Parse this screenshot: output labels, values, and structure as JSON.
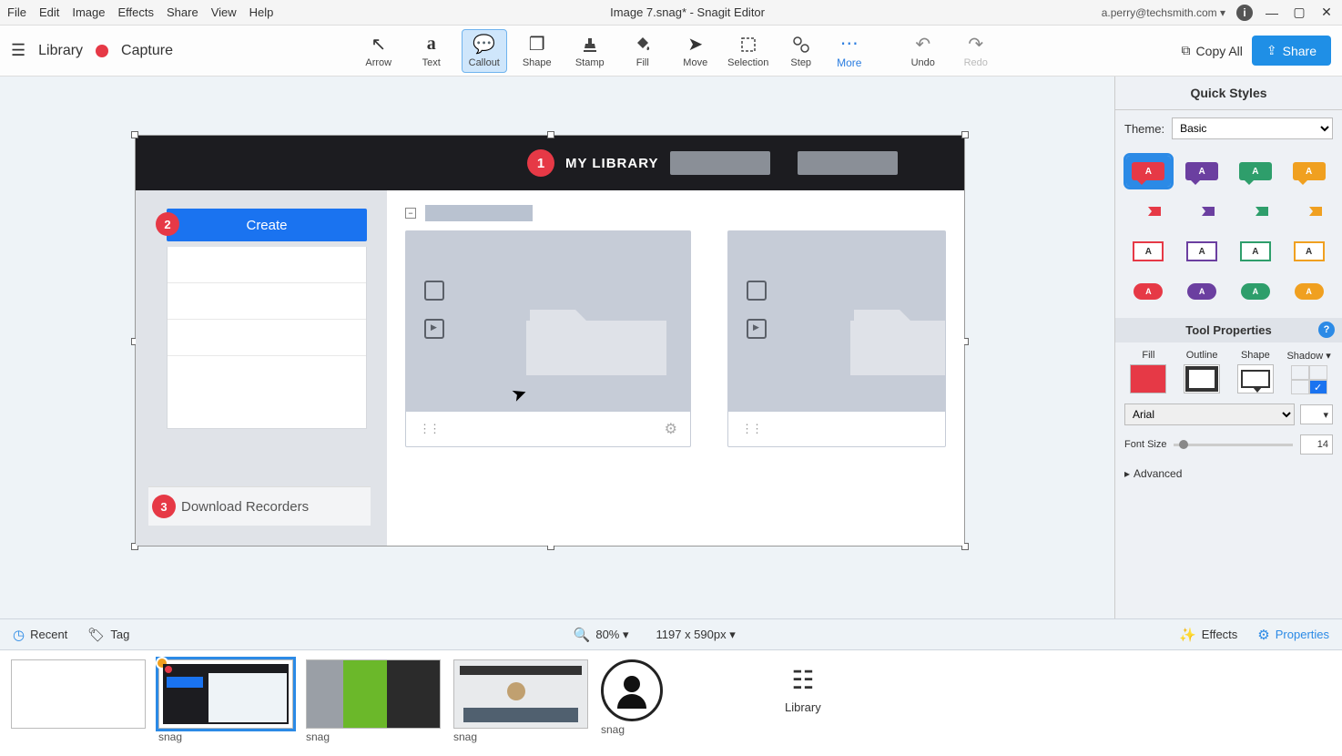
{
  "menubar": {
    "items": [
      "File",
      "Edit",
      "Image",
      "Effects",
      "Share",
      "View",
      "Help"
    ],
    "title": "Image 7.snag* - Snagit Editor",
    "user": "a.perry@techsmith.com ▾"
  },
  "toolbar": {
    "library": "Library",
    "capture": "Capture",
    "tools": [
      {
        "key": "arrow",
        "label": "Arrow"
      },
      {
        "key": "text",
        "label": "Text"
      },
      {
        "key": "callout",
        "label": "Callout",
        "selected": true
      },
      {
        "key": "shape",
        "label": "Shape"
      },
      {
        "key": "stamp",
        "label": "Stamp"
      },
      {
        "key": "fill",
        "label": "Fill"
      },
      {
        "key": "move",
        "label": "Move"
      },
      {
        "key": "selection",
        "label": "Selection"
      },
      {
        "key": "step",
        "label": "Step"
      }
    ],
    "more": "More",
    "undo": "Undo",
    "redo": "Redo",
    "copy_all": "Copy All",
    "share": "Share"
  },
  "canvas_image": {
    "header_title": "MY LIBRARY",
    "steps": [
      "1",
      "2",
      "3"
    ],
    "create_label": "Create",
    "download_label": "Download Recorders"
  },
  "quick_styles": {
    "title": "Quick Styles",
    "theme_label": "Theme:",
    "theme_value": "Basic",
    "colors": {
      "red": "#e63946",
      "purple": "#6b3fa0",
      "green": "#2e9e6b",
      "orange": "#f0a020"
    }
  },
  "tool_props": {
    "title": "Tool Properties",
    "labels": {
      "fill": "Fill",
      "outline": "Outline",
      "shape": "Shape",
      "shadow": "Shadow ▾"
    },
    "font": "Arial",
    "font_size_label": "Font Size",
    "font_size_value": "14",
    "advanced": "Advanced"
  },
  "statusbar": {
    "recent": "Recent",
    "tag": "Tag",
    "zoom": "80% ▾",
    "dims": "1197 x 590px ▾",
    "effects": "Effects",
    "properties": "Properties"
  },
  "tray": {
    "thumbs": [
      {
        "label": ""
      },
      {
        "label": "snag",
        "selected": true,
        "badge": true
      },
      {
        "label": "snag"
      },
      {
        "label": "snag"
      },
      {
        "label": "snag",
        "avatar": true
      }
    ],
    "library": "Library"
  }
}
